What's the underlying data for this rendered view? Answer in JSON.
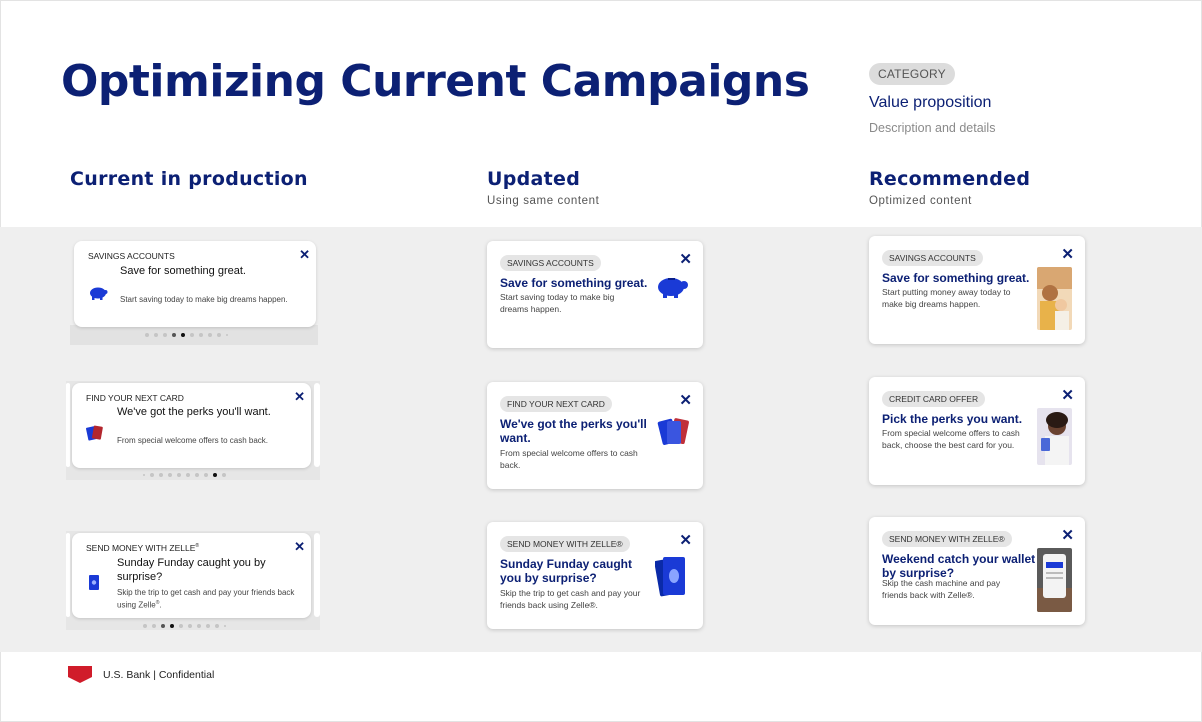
{
  "title": "Optimizing Current Campaigns",
  "legend": {
    "category": "CATEGORY",
    "value": "Value proposition",
    "description": "Description and details"
  },
  "columns": [
    {
      "heading": "Current in production",
      "sub": ""
    },
    {
      "heading": "Updated",
      "sub": "Using same content"
    },
    {
      "heading": "Recommended",
      "sub": "Optimized content"
    }
  ],
  "current": [
    {
      "category": "SAVINGS ACCOUNTS",
      "title": "Save for something great.",
      "text": "Start saving today to make big dreams happen.",
      "icon": "piggy-bank-icon"
    },
    {
      "category": "FIND YOUR NEXT CARD",
      "title": "We've got the perks you'll want.",
      "text": "From special welcome offers to cash back.",
      "icon": "credit-cards-icon"
    },
    {
      "category": "SEND MONEY WITH ZELLE",
      "category_mark": "®",
      "title": "Sunday Funday caught you by surprise?",
      "text": "Skip the trip to get cash and pay your friends back using Zelle",
      "text_mark": "®",
      "text_end": ".",
      "icon": "money-icon"
    }
  ],
  "updated": [
    {
      "category": "SAVINGS ACCOUNTS",
      "title": "Save for something great.",
      "text": "Start saving today to make big dreams happen.",
      "icon": "piggy-bank-icon"
    },
    {
      "category": "FIND YOUR NEXT CARD",
      "title": "We've got the perks you'll want.",
      "text": "From special welcome offers to cash back.",
      "icon": "credit-cards-icon"
    },
    {
      "category": "SEND MONEY WITH ZELLE®",
      "title": "Sunday Funday caught you by surprise?",
      "text": "Skip the trip to get cash and pay your friends back using Zelle®.",
      "icon": "money-icon"
    }
  ],
  "recommended": [
    {
      "category": "SAVINGS ACCOUNTS",
      "title": "Save for something great.",
      "text": "Start putting money away today to make big dreams happen.",
      "photo": "family-photo"
    },
    {
      "category": "CREDIT CARD OFFER",
      "title": "Pick the perks you want.",
      "text": "From special welcome offers to cash back, choose the best card for you.",
      "photo": "woman-with-card-photo"
    },
    {
      "category": "SEND MONEY WITH ZELLE®",
      "title": "Weekend catch your wallet by surprise?",
      "text": "Skip the cash machine and pay friends back with Zelle®.",
      "photo": "phone-in-hand-photo"
    }
  ],
  "close_glyph": "✕",
  "footer": {
    "text": "U.S. Bank | Confidential"
  },
  "colors": {
    "navy": "#0c2074",
    "band": "#efefef",
    "brand_red": "#d01c2a",
    "icon_blue": "#1a3ad6"
  }
}
